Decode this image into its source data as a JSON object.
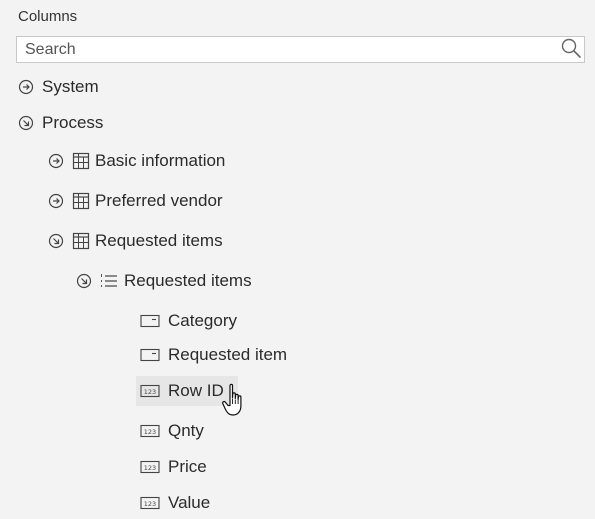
{
  "panel": {
    "title": "Columns",
    "search": {
      "placeholder": "Search",
      "value": ""
    }
  },
  "tree": {
    "system": {
      "label": "System",
      "state": "collapsed",
      "icon": "circle-arrow-right-icon"
    },
    "process": {
      "label": "Process",
      "state": "expanded",
      "icon": "circle-arrow-down-right-icon",
      "basic_information": {
        "label": "Basic information",
        "state": "collapsed",
        "icon": "table-icon"
      },
      "preferred_vendor": {
        "label": "Preferred vendor",
        "state": "collapsed",
        "icon": "table-icon"
      },
      "requested_items_table": {
        "label": "Requested items",
        "state": "expanded",
        "icon": "table-icon",
        "requested_items_list": {
          "label": "Requested items",
          "state": "expanded",
          "icon": "list-icon",
          "fields": [
            {
              "label": "Category",
              "icon": "dropdown-field-icon"
            },
            {
              "label": "Requested item",
              "icon": "dropdown-field-icon"
            },
            {
              "label": "Row ID",
              "icon": "number-field-icon",
              "hovered": true
            },
            {
              "label": "Qnty",
              "icon": "number-field-icon"
            },
            {
              "label": "Price",
              "icon": "number-field-icon"
            },
            {
              "label": "Value",
              "icon": "number-field-icon"
            }
          ]
        }
      }
    }
  },
  "cursor": "hand-pointer-icon"
}
